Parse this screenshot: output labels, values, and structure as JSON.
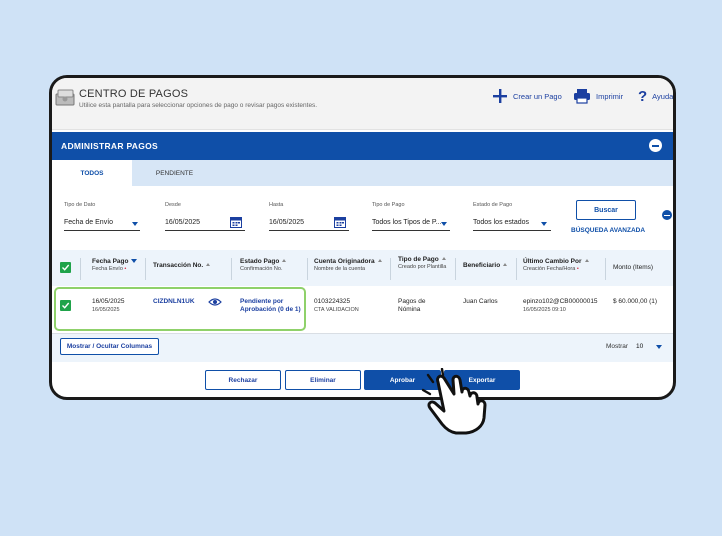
{
  "header": {
    "title": "CENTRO DE PAGOS",
    "subtitle": "Utilice esta pantalla para seleccionar opciones de pago o revisar pagos existentes.",
    "create_label": "Crear un Pago",
    "print_label": "Imprimir",
    "help_label": "Ayuda"
  },
  "section": {
    "title": "ADMINISTRAR PAGOS"
  },
  "tabs": [
    {
      "label": "TODOS",
      "active": true
    },
    {
      "label": "PENDIENTE",
      "active": false
    }
  ],
  "filters": {
    "tipo_dato": {
      "label": "Tipo de Dato",
      "value": "Fecha de Envío"
    },
    "desde": {
      "label": "Desde",
      "value": "16/05/2025"
    },
    "hasta": {
      "label": "Hasta",
      "value": "16/05/2025"
    },
    "tipo_pago": {
      "label": "Tipo de Pago",
      "value": "Todos los Tipos de P..."
    },
    "estado_pago": {
      "label": "Estado de Pago",
      "value": "Todos los estados"
    },
    "buscar_label": "Buscar",
    "advanced_label": "BÚSQUEDA AVANZADA"
  },
  "table": {
    "columns": [
      {
        "title": "Fecha Pago",
        "sub": "Fecha Envío"
      },
      {
        "title": "Transacción No.",
        "sub": ""
      },
      {
        "title": "Estado Pago",
        "sub": "Confirmación No."
      },
      {
        "title": "Cuenta Originadora",
        "sub": "Nombre de la cuenta"
      },
      {
        "title": "Tipo de Pago",
        "sub": "Creado por Plantilla"
      },
      {
        "title": "Beneficiario",
        "sub": ""
      },
      {
        "title": "Último Cambio Por",
        "sub": "Creación Fecha/Hora"
      },
      {
        "title": "Monto (Items)",
        "sub": ""
      }
    ],
    "rows": [
      {
        "selected": true,
        "fecha_pago": "16/05/2025",
        "fecha_envio": "16/05/2025",
        "transaccion": "CIZDNLN1UK",
        "estado": "Pendiente por Aprobación (0 de 1)",
        "cuenta": "0103224325",
        "cuenta_nombre": "CTA VALIDACION",
        "tipo_pago": "Pagos de Nómina",
        "beneficiario": "Juan Carlos",
        "ultimo_cambio": "epinzo102@CB00000015",
        "creacion": "16/05/2025 09:10",
        "monto": "$ 60.000,00 (1)"
      }
    ]
  },
  "footer": {
    "show_columns_label": "Mostrar / Ocultar Columnas",
    "mostrar_label": "Mostrar",
    "mostrar_value": "10"
  },
  "actions": {
    "rechazar": "Rechazar",
    "eliminar": "Eliminar",
    "aprobar": "Aprobar",
    "exportar": "Exportar"
  },
  "colors": {
    "primary": "#0f4fa8",
    "success": "#1fa34a",
    "highlight": "#8fd16a",
    "background": "#cfe2f6"
  },
  "icons": [
    "wallet-icon",
    "plus-icon",
    "printer-icon",
    "help-icon",
    "collapse-icon",
    "calendar-icon",
    "eye-icon",
    "checkbox-icon",
    "pointer-hand-icon"
  ]
}
